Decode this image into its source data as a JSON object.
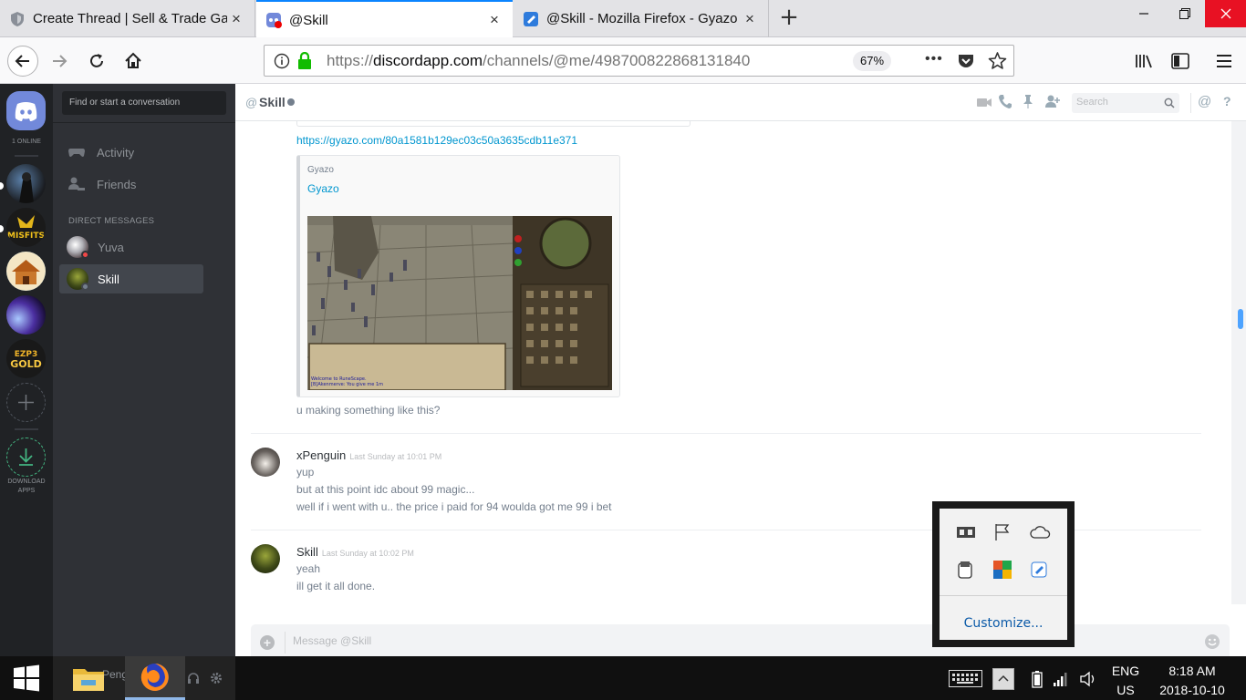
{
  "browser": {
    "tabs": [
      {
        "title": "Create Thread | Sell & Trade Ga",
        "close": "×",
        "active": false
      },
      {
        "title": "@Skill",
        "close": "×",
        "active": true
      },
      {
        "title": "@Skill - Mozilla Firefox - Gyazo",
        "close": "×",
        "active": false
      }
    ],
    "new_tab": "+",
    "url_prefix": "https://",
    "url_domain": "discordapp.com",
    "url_path": "/channels/@me/498700822868131840",
    "zoom": "67%",
    "page_actions": "•••"
  },
  "discord": {
    "online_count": "1 ONLINE",
    "download_label": "DOWNLOAD APPS",
    "search_placeholder": "Find or start a conversation",
    "nav": [
      {
        "label": "Activity"
      },
      {
        "label": "Friends"
      }
    ],
    "dm_header": "DIRECT MESSAGES",
    "dms": [
      {
        "name": "Yuva",
        "status_color": "#f04747"
      },
      {
        "name": "Skill",
        "status_color": "#747f8d"
      }
    ],
    "user_panel_name": "xPenguin",
    "channel": {
      "at": "@",
      "name": "Skill",
      "search_placeholder": "Search",
      "mention_icon": "@",
      "help_icon": "?"
    },
    "messages": {
      "link": "https://gyazo.com/80a1581b129ec03c50a3635cdb11e371",
      "embed_provider": "Gyazo",
      "embed_title": "Gyazo",
      "embed_text_1": "Welcome to RuneScape.",
      "embed_text_2": "[B]Akenmerve: You give me 1m",
      "first_text": "u making something like this?",
      "groups": [
        {
          "author": "xPenguin",
          "timestamp": "Last Sunday at 10:01 PM",
          "lines": [
            "yup",
            "but at this point idc about 99 magic...",
            "well if i went with u.. the price i paid for 94 woulda got me 99 i bet"
          ]
        },
        {
          "author": "Skill",
          "timestamp": "Last Sunday at 10:02 PM",
          "lines": [
            "yeah",
            "ill get it all done."
          ]
        }
      ]
    },
    "composer_placeholder": "Message @Skill",
    "server_art": {
      "misfits": "MISFITS",
      "gold": "GOLD",
      "ezp": "EZP3"
    }
  },
  "tray_popup": {
    "customize": "Customize..."
  },
  "taskbar": {
    "lang_1": "ENG",
    "lang_2": "US",
    "time": "8:18 AM",
    "date": "2018-10-10"
  }
}
